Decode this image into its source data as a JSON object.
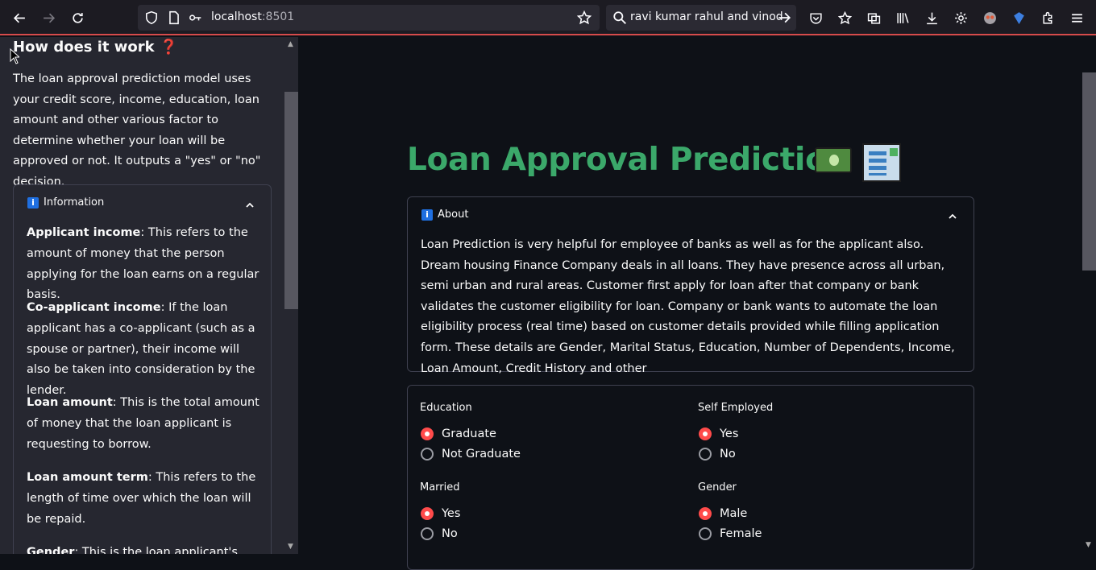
{
  "browser": {
    "url_host": "localhost",
    "url_port": ":8501",
    "search_text": "ravi kumar rahul and vinod"
  },
  "sidebar": {
    "title": "How does it work",
    "title_emoji": "❓",
    "intro": "The loan approval prediction model uses your credit score, income, education, loan amount and other various factor to determine whether your loan will be approved or not. It outputs a \"yes\" or \"no\" decision.",
    "info_expander": {
      "label": "Information",
      "items": [
        {
          "term": "Applicant income",
          "text": ": This refers to the amount of money that the person applying for the loan earns on a regular basis."
        },
        {
          "term": "Co-applicant income",
          "text": ": If the loan applicant has a co-applicant (such as a spouse or partner), their income will also be taken into consideration by the lender."
        },
        {
          "term": "Loan amount",
          "text": ": This is the total amount of money that the loan applicant is requesting to borrow."
        },
        {
          "term": "Loan amount term",
          "text": ": This refers to the length of time over which the loan will be repaid."
        },
        {
          "term": "Gender",
          "text": ": This is the loan applicant's gender."
        }
      ]
    }
  },
  "main": {
    "title": "Loan Approval Prediction",
    "about_expander": {
      "label": "About",
      "text": "Loan Prediction is very helpful for employee of banks as well as for the applicant also. Dream housing Finance Company deals in all loans. They have presence across all urban, semi urban and rural areas. Customer first apply for loan after that company or bank validates the customer eligibility for loan. Company or bank wants to automate the loan eligibility process (real time) based on customer details provided while filling application form. These details are Gender, Marital Status, Education, Number of Dependents, Income, Loan Amount, Credit History and other"
    },
    "form": {
      "education": {
        "label": "Education",
        "options": [
          "Graduate",
          "Not Graduate"
        ],
        "selected": "Graduate"
      },
      "self_employed": {
        "label": "Self Employed",
        "options": [
          "Yes",
          "No"
        ],
        "selected": "Yes"
      },
      "married": {
        "label": "Married",
        "options": [
          "Yes",
          "No"
        ],
        "selected": "Yes"
      },
      "gender": {
        "label": "Gender",
        "options": [
          "Male",
          "Female"
        ],
        "selected": "Male"
      }
    }
  },
  "colors": {
    "accent": "#ff4b4b",
    "title_green": "#3ba86a",
    "background": "#0e1117",
    "sidebar_bg": "#262730"
  }
}
